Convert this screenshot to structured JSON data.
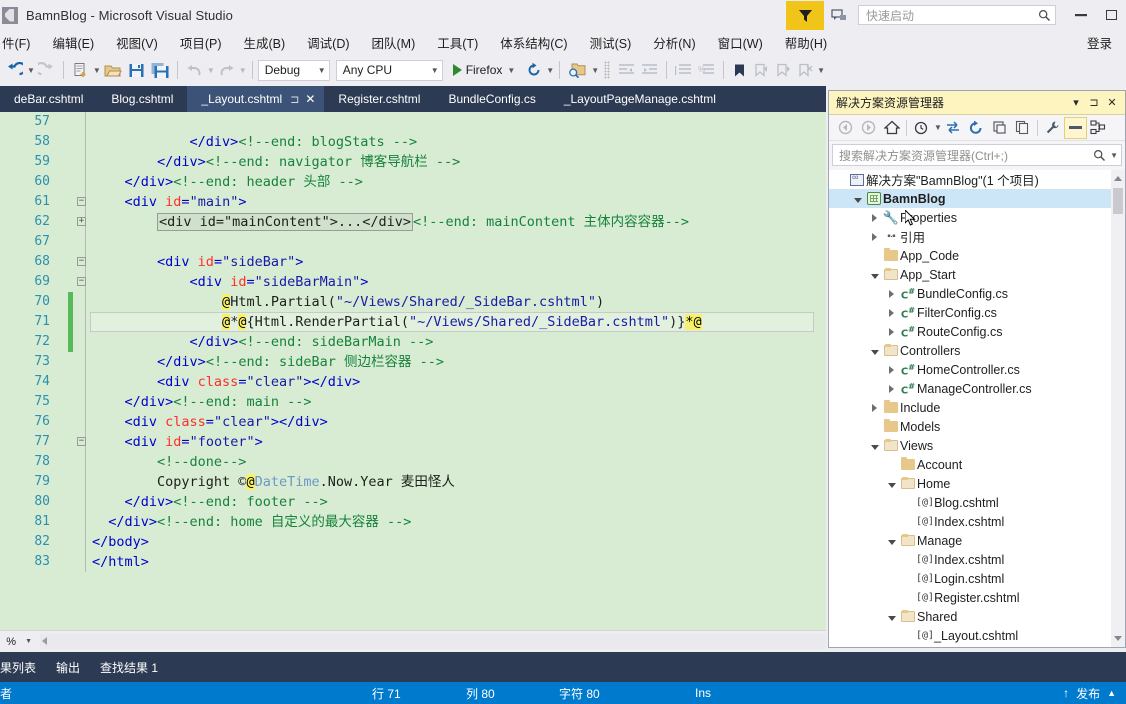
{
  "window": {
    "title": "BamnBlog - Microsoft Visual Studio",
    "logo_icon": "visual-studio-logo",
    "minimize_label": "—",
    "maximize_label": "□"
  },
  "titlebar_right": {
    "funnel_icon": "funnel-filter-icon",
    "feedback_icon": "send-feedback-icon",
    "quicklaunch_placeholder": "快速启动",
    "search_icon": "search-icon"
  },
  "menu": {
    "items": [
      {
        "label": "件(F)"
      },
      {
        "label": "编辑(E)"
      },
      {
        "label": "视图(V)"
      },
      {
        "label": "项目(P)"
      },
      {
        "label": "生成(B)"
      },
      {
        "label": "调试(D)"
      },
      {
        "label": "团队(M)"
      },
      {
        "label": "工具(T)"
      },
      {
        "label": "体系结构(C)"
      },
      {
        "label": "测试(S)"
      },
      {
        "label": "分析(N)"
      },
      {
        "label": "窗口(W)"
      },
      {
        "label": "帮助(H)"
      }
    ],
    "signin_label": "登录"
  },
  "toolbar": {
    "back_icon": "navigate-backward-icon",
    "forward_icon": "navigate-forward-icon",
    "new_item_icon": "new-item-icon",
    "open_icon": "open-file-icon",
    "save_icon": "save-icon",
    "save_all_icon": "save-all-icon",
    "undo_icon": "undo-icon",
    "redo_icon": "redo-icon",
    "configuration": "Debug",
    "platform": "Any CPU",
    "run_target": "Firefox",
    "run_icon": "play-icon",
    "refresh_icon": "refresh-icon",
    "find_icon": "find-in-files-icon",
    "indent_icon": "indent-icon",
    "outdent_icon": "outdent-icon",
    "comment_icon": "comment-icon",
    "uncomment_icon": "uncomment-icon",
    "bookmark_icon": "bookmark-icon",
    "prev_bookmark_icon": "previous-bookmark-icon",
    "next_bookmark_icon": "next-bookmark-icon",
    "clear_bookmarks_icon": "clear-bookmarks-icon",
    "overflow_icon": "toolbar-overflow-icon"
  },
  "tabs": [
    {
      "label": "deBar.cshtml",
      "active": false
    },
    {
      "label": "Blog.cshtml",
      "active": false
    },
    {
      "label": "_Layout.cshtml",
      "active": true,
      "pin_icon": "pin-icon",
      "close_icon": "close-icon"
    },
    {
      "label": "Register.cshtml",
      "active": false
    },
    {
      "label": "BundleConfig.cs",
      "active": false
    },
    {
      "label": "_LayoutPageManage.cshtml",
      "active": false
    }
  ],
  "editor": {
    "zoom_level": "% ",
    "current_line": 71,
    "lines": [
      {
        "n": 57,
        "indent": 0,
        "glyph": "",
        "changed": false,
        "tokens": []
      },
      {
        "n": 58,
        "indent": 0,
        "glyph": "",
        "changed": false,
        "tokens": [
          {
            "t": "plain",
            "s": "            "
          },
          {
            "t": "tag",
            "s": "</div>"
          },
          {
            "t": "cmt",
            "s": "<!--end: blogStats -->"
          }
        ]
      },
      {
        "n": 59,
        "indent": 0,
        "glyph": "",
        "changed": false,
        "tokens": [
          {
            "t": "plain",
            "s": "        "
          },
          {
            "t": "tag",
            "s": "</div>"
          },
          {
            "t": "cmt",
            "s": "<!--end: navigator 博客导航栏 -->"
          }
        ]
      },
      {
        "n": 60,
        "indent": 0,
        "glyph": "",
        "changed": false,
        "tokens": [
          {
            "t": "plain",
            "s": "    "
          },
          {
            "t": "tag",
            "s": "</div>"
          },
          {
            "t": "cmt",
            "s": "<!--end: header 头部 -->"
          }
        ]
      },
      {
        "n": 61,
        "indent": 0,
        "glyph": "minus",
        "changed": false,
        "tokens": [
          {
            "t": "plain",
            "s": "    "
          },
          {
            "t": "tag",
            "s": "<div "
          },
          {
            "t": "attr",
            "s": "id"
          },
          {
            "t": "punct",
            "s": "="
          },
          {
            "t": "val",
            "s": "\"main\""
          },
          {
            "t": "tag",
            "s": ">"
          }
        ]
      },
      {
        "n": 62,
        "indent": 0,
        "glyph": "plus",
        "changed": false,
        "collapsed": "<div id=\"mainContent\">...</div>",
        "tokens": [
          {
            "t": "cmt",
            "s": "<!--end: mainContent 主体内容容器-->"
          }
        ]
      },
      {
        "n": 67,
        "indent": 0,
        "glyph": "",
        "changed": false,
        "tokens": []
      },
      {
        "n": 68,
        "indent": 0,
        "glyph": "minus",
        "changed": false,
        "tokens": [
          {
            "t": "plain",
            "s": "        "
          },
          {
            "t": "tag",
            "s": "<div "
          },
          {
            "t": "attr",
            "s": "id"
          },
          {
            "t": "punct",
            "s": "="
          },
          {
            "t": "val",
            "s": "\"sideBar\""
          },
          {
            "t": "tag",
            "s": ">"
          }
        ]
      },
      {
        "n": 69,
        "indent": 0,
        "glyph": "minus",
        "changed": false,
        "tokens": [
          {
            "t": "plain",
            "s": "            "
          },
          {
            "t": "tag",
            "s": "<div "
          },
          {
            "t": "attr",
            "s": "id"
          },
          {
            "t": "punct",
            "s": "="
          },
          {
            "t": "val",
            "s": "\"sideBarMain\""
          },
          {
            "t": "tag",
            "s": ">"
          }
        ]
      },
      {
        "n": 70,
        "indent": 0,
        "glyph": "",
        "changed": true,
        "tokens": [
          {
            "t": "plain",
            "s": "                "
          },
          {
            "t": "hl",
            "s": "@"
          },
          {
            "t": "plain",
            "s": "Html.Partial("
          },
          {
            "t": "val",
            "s": "\"~/Views/Shared/_SideBar.cshtml\""
          },
          {
            "t": "plain",
            "s": ")"
          }
        ]
      },
      {
        "n": 71,
        "indent": 0,
        "glyph": "",
        "changed": true,
        "current": true,
        "tokens": [
          {
            "t": "plain",
            "s": "                "
          },
          {
            "t": "hl",
            "s": "@"
          },
          {
            "t": "plain",
            "s": "*"
          },
          {
            "t": "hl",
            "s": "@"
          },
          {
            "t": "plain",
            "s": "{Html.RenderPartial("
          },
          {
            "t": "val",
            "s": "\"~/Views/Shared/_SideBar.cshtml\""
          },
          {
            "t": "plain",
            "s": ")}"
          },
          {
            "t": "hl",
            "s": "*@"
          }
        ]
      },
      {
        "n": 72,
        "indent": 0,
        "glyph": "",
        "changed": true,
        "tokens": [
          {
            "t": "plain",
            "s": "            "
          },
          {
            "t": "tag",
            "s": "</div>"
          },
          {
            "t": "cmt",
            "s": "<!--end: sideBarMain -->"
          }
        ]
      },
      {
        "n": 73,
        "indent": 0,
        "glyph": "",
        "changed": false,
        "tokens": [
          {
            "t": "plain",
            "s": "        "
          },
          {
            "t": "tag",
            "s": "</div>"
          },
          {
            "t": "cmt",
            "s": "<!--end: sideBar 侧边栏容器 -->"
          }
        ]
      },
      {
        "n": 74,
        "indent": 0,
        "glyph": "",
        "changed": false,
        "tokens": [
          {
            "t": "plain",
            "s": "        "
          },
          {
            "t": "tag",
            "s": "<div "
          },
          {
            "t": "attr",
            "s": "class"
          },
          {
            "t": "punct",
            "s": "="
          },
          {
            "t": "val",
            "s": "\"clear\""
          },
          {
            "t": "tag",
            "s": "></div>"
          }
        ]
      },
      {
        "n": 75,
        "indent": 0,
        "glyph": "",
        "changed": false,
        "tokens": [
          {
            "t": "plain",
            "s": "    "
          },
          {
            "t": "tag",
            "s": "</div>"
          },
          {
            "t": "cmt",
            "s": "<!--end: main -->"
          }
        ]
      },
      {
        "n": 76,
        "indent": 0,
        "glyph": "",
        "changed": false,
        "tokens": [
          {
            "t": "plain",
            "s": "    "
          },
          {
            "t": "tag",
            "s": "<div "
          },
          {
            "t": "attr",
            "s": "class"
          },
          {
            "t": "punct",
            "s": "="
          },
          {
            "t": "val",
            "s": "\"clear\""
          },
          {
            "t": "tag",
            "s": "></div>"
          }
        ]
      },
      {
        "n": 77,
        "indent": 0,
        "glyph": "minus",
        "changed": false,
        "tokens": [
          {
            "t": "plain",
            "s": "    "
          },
          {
            "t": "tag",
            "s": "<div "
          },
          {
            "t": "attr",
            "s": "id"
          },
          {
            "t": "punct",
            "s": "="
          },
          {
            "t": "val",
            "s": "\"footer\""
          },
          {
            "t": "tag",
            "s": ">"
          }
        ]
      },
      {
        "n": 78,
        "indent": 0,
        "glyph": "",
        "changed": false,
        "tokens": [
          {
            "t": "plain",
            "s": "        "
          },
          {
            "t": "cmt",
            "s": "<!--done-->"
          }
        ]
      },
      {
        "n": 79,
        "indent": 0,
        "glyph": "",
        "changed": false,
        "tokens": [
          {
            "t": "plain",
            "s": "        Copyright ©"
          },
          {
            "t": "hl",
            "s": "@"
          },
          {
            "t": "type",
            "s": "DateTime"
          },
          {
            "t": "plain",
            "s": ".Now.Year 麦田怪人"
          }
        ]
      },
      {
        "n": 80,
        "indent": 0,
        "glyph": "",
        "changed": false,
        "tokens": [
          {
            "t": "plain",
            "s": "    "
          },
          {
            "t": "tag",
            "s": "</div>"
          },
          {
            "t": "cmt",
            "s": "<!--end: footer -->"
          }
        ]
      },
      {
        "n": 81,
        "indent": 0,
        "glyph": "",
        "changed": false,
        "tokens": [
          {
            "t": "plain",
            "s": "  "
          },
          {
            "t": "tag",
            "s": "</div>"
          },
          {
            "t": "cmt",
            "s": "<!--end: home 自定义的最大容器 -->"
          }
        ]
      },
      {
        "n": 82,
        "indent": 0,
        "glyph": "",
        "changed": false,
        "tokens": [
          {
            "t": "tag",
            "s": "</body>"
          }
        ]
      },
      {
        "n": 83,
        "indent": 0,
        "glyph": "",
        "changed": false,
        "tokens": [
          {
            "t": "tag",
            "s": "</html>"
          }
        ]
      }
    ]
  },
  "solution_explorer": {
    "title": "解决方案资源管理器",
    "dropdown_icon": "chevron-down-icon",
    "pin_icon": "pin-icon",
    "close_icon": "close-icon",
    "search_placeholder": "搜索解决方案资源管理器(Ctrl+;)",
    "toolbar": {
      "back_icon": "back-icon",
      "forward_icon": "forward-icon",
      "home_icon": "home-icon",
      "pending_changes_icon": "pending-changes-filter-icon",
      "sync_icon": "sync-with-active-document-icon",
      "refresh_icon": "refresh-icon",
      "collapse_all_icon": "collapse-all-icon",
      "show_all_files_icon": "show-all-files-icon",
      "properties_icon": "properties-wrench-icon",
      "preview_icon": "preview-selected-items-icon",
      "class_view_icon": "class-view-icon"
    },
    "tree": [
      {
        "depth": 0,
        "icon": "solution-icon",
        "label": "解决方案\"BamnBlog\"(1 个项目)",
        "twisty": "none",
        "bold": false
      },
      {
        "depth": 1,
        "icon": "project-icon",
        "label": "BamnBlog",
        "twisty": "open",
        "bold": true,
        "selected": true
      },
      {
        "depth": 2,
        "icon": "wrench-icon",
        "label": "Properties",
        "twisty": "closed",
        "bold": false
      },
      {
        "depth": 2,
        "icon": "references-icon",
        "label": "引用",
        "twisty": "closed",
        "bold": false
      },
      {
        "depth": 2,
        "icon": "folder-icon",
        "label": "App_Code",
        "twisty": "none",
        "bold": false
      },
      {
        "depth": 2,
        "icon": "folder-open-icon",
        "label": "App_Start",
        "twisty": "open",
        "bold": false
      },
      {
        "depth": 3,
        "icon": "csharp-icon",
        "label": "BundleConfig.cs",
        "twisty": "closed",
        "bold": false
      },
      {
        "depth": 3,
        "icon": "csharp-icon",
        "label": "FilterConfig.cs",
        "twisty": "closed",
        "bold": false
      },
      {
        "depth": 3,
        "icon": "csharp-icon",
        "label": "RouteConfig.cs",
        "twisty": "closed",
        "bold": false
      },
      {
        "depth": 2,
        "icon": "folder-open-icon",
        "label": "Controllers",
        "twisty": "open",
        "bold": false
      },
      {
        "depth": 3,
        "icon": "csharp-icon",
        "label": "HomeController.cs",
        "twisty": "closed",
        "bold": false
      },
      {
        "depth": 3,
        "icon": "csharp-icon",
        "label": "ManageController.cs",
        "twisty": "closed",
        "bold": false
      },
      {
        "depth": 2,
        "icon": "folder-icon",
        "label": "Include",
        "twisty": "closed",
        "bold": false
      },
      {
        "depth": 2,
        "icon": "folder-icon",
        "label": "Models",
        "twisty": "none",
        "bold": false
      },
      {
        "depth": 2,
        "icon": "folder-open-icon",
        "label": "Views",
        "twisty": "open",
        "bold": false
      },
      {
        "depth": 3,
        "icon": "folder-icon",
        "label": "Account",
        "twisty": "none",
        "bold": false
      },
      {
        "depth": 3,
        "icon": "folder-open-icon",
        "label": "Home",
        "twisty": "open",
        "bold": false
      },
      {
        "depth": 4,
        "icon": "razor-icon",
        "label": "Blog.cshtml",
        "twisty": "none",
        "bold": false
      },
      {
        "depth": 4,
        "icon": "razor-icon",
        "label": "Index.cshtml",
        "twisty": "none",
        "bold": false
      },
      {
        "depth": 3,
        "icon": "folder-open-icon",
        "label": "Manage",
        "twisty": "open",
        "bold": false
      },
      {
        "depth": 4,
        "icon": "razor-icon",
        "label": "Index.cshtml",
        "twisty": "none",
        "bold": false
      },
      {
        "depth": 4,
        "icon": "razor-icon",
        "label": "Login.cshtml",
        "twisty": "none",
        "bold": false
      },
      {
        "depth": 4,
        "icon": "razor-icon",
        "label": "Register.cshtml",
        "twisty": "none",
        "bold": false
      },
      {
        "depth": 3,
        "icon": "folder-open-icon",
        "label": "Shared",
        "twisty": "open",
        "bold": false
      },
      {
        "depth": 4,
        "icon": "razor-icon",
        "label": "_Layout.cshtml",
        "twisty": "none",
        "bold": false
      }
    ]
  },
  "bottom_panel": {
    "tabs": [
      {
        "label": "果列表"
      },
      {
        "label": "输出"
      },
      {
        "label": "查找结果 1"
      }
    ]
  },
  "statusbar": {
    "message": "者",
    "line_label": "行",
    "line_value": "71",
    "col_label": "列",
    "col_value": "80",
    "char_label": "字符",
    "char_value": "80",
    "insert_mode": "Ins",
    "publish_icon": "upload-arrow-icon",
    "publish_label": "发布",
    "publish_caret": "▲"
  },
  "colors": {
    "accent_blue": "#007acc",
    "tab_strip": "#2d3a53",
    "active_tab": "#3d5277",
    "editor_bg": "#d7ecd2",
    "solex_header": "#fdf4bf",
    "funnel_yellow": "#f0c419",
    "change_bar_green": "#57b957"
  }
}
